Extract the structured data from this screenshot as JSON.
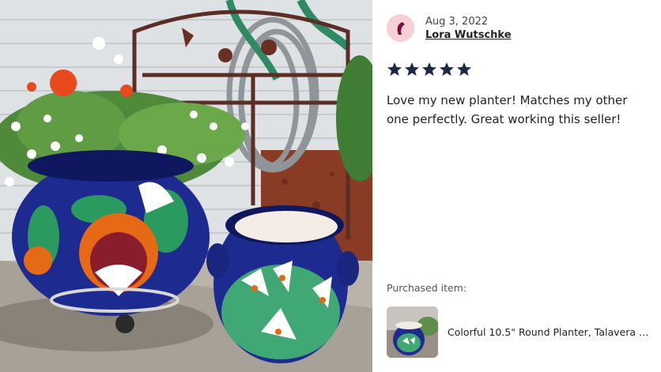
{
  "photo": {
    "alt": "Two Talavera planters on a patio, one with red and white flowers"
  },
  "review": {
    "date": "Aug 3, 2022",
    "reviewer_name": "Lora Wutschke",
    "rating": 5,
    "rating_max": 5,
    "text": "Love my new planter! Matches my other one perfectly. Great working this seller!"
  },
  "purchased": {
    "label": "Purchased item:",
    "item_title": "Colorful 10.5\" Round Planter, Talavera C..."
  },
  "colors": {
    "star": "#1c2a47",
    "avatar_bg": "#f7cfd6",
    "avatar_fg": "#7a0f3f"
  }
}
